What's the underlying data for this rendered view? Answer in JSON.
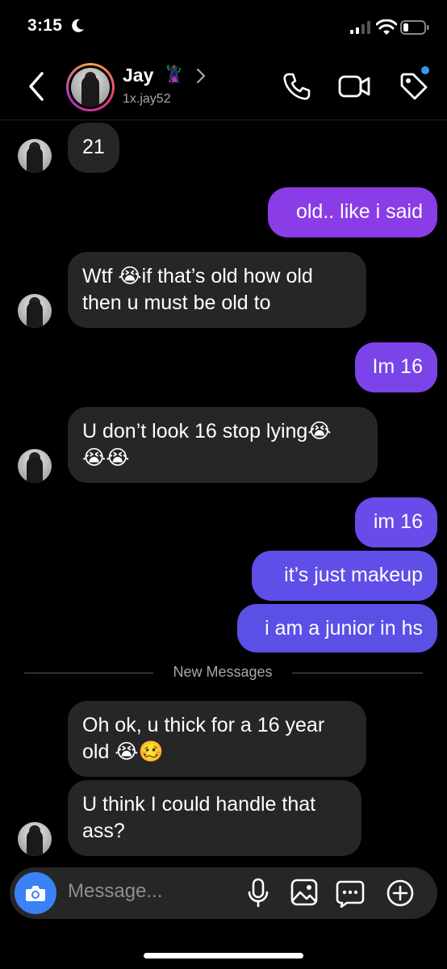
{
  "status_bar": {
    "time": "3:15"
  },
  "header": {
    "name": "Jay",
    "emoji": "🦹🏾",
    "username": "1x.jay52"
  },
  "messages": [
    {
      "from": "them",
      "text": "21"
    },
    {
      "from": "me",
      "text": "old.. like i said"
    },
    {
      "from": "them",
      "text": "Wtf 😭if that’s old how old\nthen u must be old to"
    },
    {
      "from": "me",
      "text": "Im 16"
    },
    {
      "from": "them",
      "text": "U don’t look 16 stop lying😭\n😭😭"
    },
    {
      "from": "me",
      "text": "im 16"
    },
    {
      "from": "me",
      "text": "it’s just makeup"
    },
    {
      "from": "me",
      "text": "i am a junior in hs"
    },
    {
      "from": "them",
      "text": "Oh ok, u thick for a 16 year\nold 😭🥴"
    },
    {
      "from": "them",
      "text": "U think I could handle that\nass?"
    }
  ],
  "divider": {
    "label": "New Messages"
  },
  "composer": {
    "placeholder": "Message..."
  },
  "colors": {
    "accent": "#3b82f6",
    "outgoing_top": "#8a3ce6",
    "outgoing_bottom": "#5a4fe6",
    "incoming": "#262626",
    "unread_dot": "#3897f0"
  },
  "icons": [
    "back-icon",
    "chevron-right-icon",
    "phone-icon",
    "video-camera-icon",
    "tag-icon",
    "camera-icon",
    "microphone-icon",
    "gallery-icon",
    "sticker-icon",
    "plus-icon"
  ]
}
